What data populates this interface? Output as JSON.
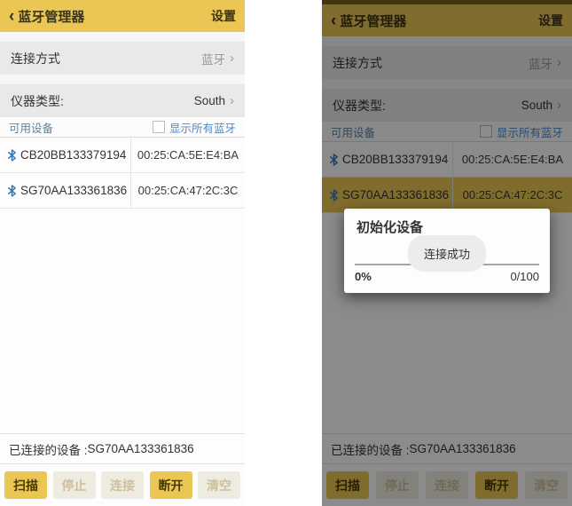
{
  "header": {
    "back_icon": "‹",
    "title": "蓝牙管理器",
    "settings_label": "设置"
  },
  "icons": {
    "chevron": "›"
  },
  "connection_row": {
    "label": "连接方式",
    "value": "蓝牙"
  },
  "instrument_row": {
    "label": "仪器类型:",
    "value": "South"
  },
  "device_list": {
    "header_label": "可用设备",
    "show_all_label": "显示所有蓝牙",
    "checkbox_checked": false,
    "devices": [
      {
        "name": "CB20BB133379194",
        "mac": "00:25:CA:5E:E4:BA"
      },
      {
        "name": "SG70AA133361836",
        "mac": "00:25:CA:47:2C:3C"
      }
    ]
  },
  "connected": {
    "label": "已连接的设备 :",
    "device": "SG70AA133361836"
  },
  "buttons": [
    {
      "label": "扫描",
      "enabled": true
    },
    {
      "label": "停止",
      "enabled": false
    },
    {
      "label": "连接",
      "enabled": false
    },
    {
      "label": "断开",
      "enabled": true
    },
    {
      "label": "清空",
      "enabled": false
    }
  ],
  "right_panel": {
    "selected_device_index": 1,
    "dialog": {
      "title": "初始化设备",
      "toast": "连接成功",
      "percent": "0%",
      "progress": "0/100"
    }
  },
  "colors": {
    "accent_gold": "#eac654",
    "dim_gold_statusbar": "#7a6214",
    "row_gray": "#e9e9e9",
    "link_blue": "#4c8bc8",
    "label_blue": "#5e83a0",
    "bluetooth_blue": "#3077b8",
    "disabled_btn_bg": "#eeebe0",
    "disabled_btn_text": "#ccc19c"
  }
}
